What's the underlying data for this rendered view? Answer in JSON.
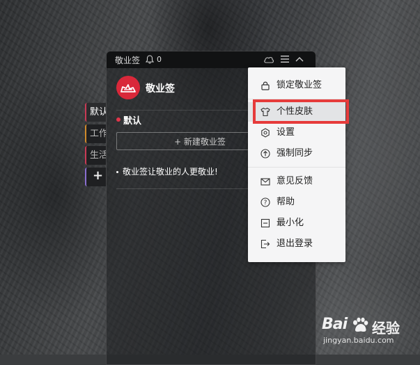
{
  "side_tabs": [
    {
      "label": "默认"
    },
    {
      "label": "工作"
    },
    {
      "label": "生活"
    },
    {
      "label": "+"
    }
  ],
  "titlebar": {
    "app_name": "敬业签",
    "notification_count": "0"
  },
  "header": {
    "brand": "敬业签"
  },
  "category": {
    "title": "默认"
  },
  "new_note": {
    "label": "+ 新建敬业签"
  },
  "notes": [
    {
      "text": "敬业签让敬业的人更敬业!"
    }
  ],
  "menu": {
    "items": [
      {
        "label": "锁定敬业签",
        "icon": "lock-icon"
      },
      {
        "label": "个性皮肤",
        "icon": "tshirt-icon",
        "highlighted": true
      },
      {
        "label": "设置",
        "icon": "gear-icon"
      },
      {
        "label": "强制同步",
        "icon": "sync-up-icon"
      },
      {
        "label": "意见反馈",
        "icon": "mail-icon"
      },
      {
        "label": "帮助",
        "icon": "help-icon"
      },
      {
        "label": "最小化",
        "icon": "minimize-icon"
      },
      {
        "label": "退出登录",
        "icon": "logout-icon"
      }
    ]
  },
  "watermark": {
    "brand": "Bai",
    "cn": "经验",
    "url": "jingyan.baidu.com"
  },
  "colors": {
    "accent_red": "#d9283a",
    "highlight_box": "#e63b3b"
  }
}
